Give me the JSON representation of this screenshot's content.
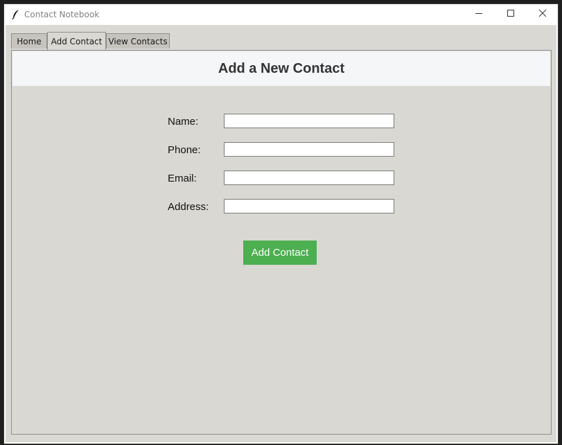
{
  "window": {
    "title": "Contact Notebook"
  },
  "tabs": [
    {
      "label": "Home"
    },
    {
      "label": "Add Contact"
    },
    {
      "label": "View Contacts"
    }
  ],
  "active_tab": "Add Contact",
  "page": {
    "title": "Add a New Contact"
  },
  "form": {
    "fields": [
      {
        "label": "Name:",
        "value": ""
      },
      {
        "label": "Phone:",
        "value": ""
      },
      {
        "label": "Email:",
        "value": ""
      },
      {
        "label": "Address:",
        "value": ""
      }
    ],
    "submit_label": "Add Contact"
  },
  "colors": {
    "submit_button": "#4caf50",
    "header_band": "#f4f6f8",
    "client_bg": "#d9d8d3"
  },
  "icons": {
    "app": "feather-icon",
    "minimize": "minimize-icon",
    "maximize": "maximize-icon",
    "close": "close-icon"
  }
}
